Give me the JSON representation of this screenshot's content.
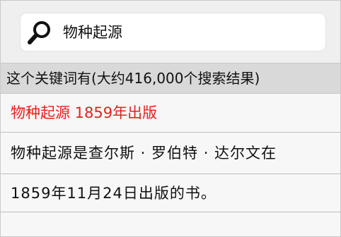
{
  "search": {
    "query": "物种起源",
    "icon": "search-icon"
  },
  "results_header": {
    "text": "这个关键词有(大约416,000个搜索结果)"
  },
  "results": [
    {
      "title": "物种起源 1859年出版",
      "title_color": "#e8201c",
      "description_line1": "物种起源是查尔斯 · 罗伯特 · 达尔文在",
      "description_line2": "1859年11月24日出版的书。"
    }
  ]
}
